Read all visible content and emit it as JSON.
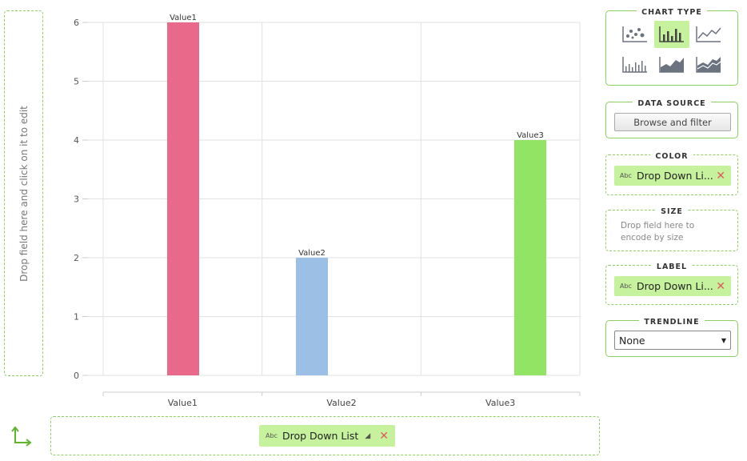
{
  "y_drop": {
    "hint": "Drop field here and click on it to edit"
  },
  "x_drop": {
    "chip_type": "Abc",
    "chip_label": "Drop Down List",
    "sort_glyph": "◢",
    "remove_glyph": "✕"
  },
  "panels": {
    "chart_type": {
      "title": "CHART TYPE",
      "types": [
        "scatter",
        "bar",
        "line",
        "bar-thin",
        "area",
        "multi-area"
      ],
      "selected": "bar"
    },
    "data_source": {
      "title": "DATA SOURCE",
      "button_label": "Browse and filter"
    },
    "color": {
      "title": "COLOR",
      "chip_type": "Abc",
      "chip_label": "Drop Down Li...",
      "remove_glyph": "✕"
    },
    "size": {
      "title": "SIZE",
      "hint_line1": "Drop field here to",
      "hint_line2": "encode by size"
    },
    "label": {
      "title": "LABEL",
      "chip_type": "Abc",
      "chip_label": "Drop Down Li...",
      "remove_glyph": "✕"
    },
    "trendline": {
      "title": "TRENDLINE",
      "selected": "None"
    }
  },
  "chart_data": {
    "type": "bar",
    "categories": [
      "Value1",
      "Value2",
      "Value3"
    ],
    "values": [
      6,
      2,
      4
    ],
    "data_labels": [
      "Value1",
      "Value2",
      "Value3"
    ],
    "colors": [
      "#e8698a",
      "#9bbfe5",
      "#92e464"
    ],
    "ylim": [
      0,
      6
    ],
    "yticks": [
      0,
      1,
      2,
      3,
      4,
      5,
      6
    ],
    "grid": true,
    "title": "",
    "xlabel": "",
    "ylabel": ""
  }
}
